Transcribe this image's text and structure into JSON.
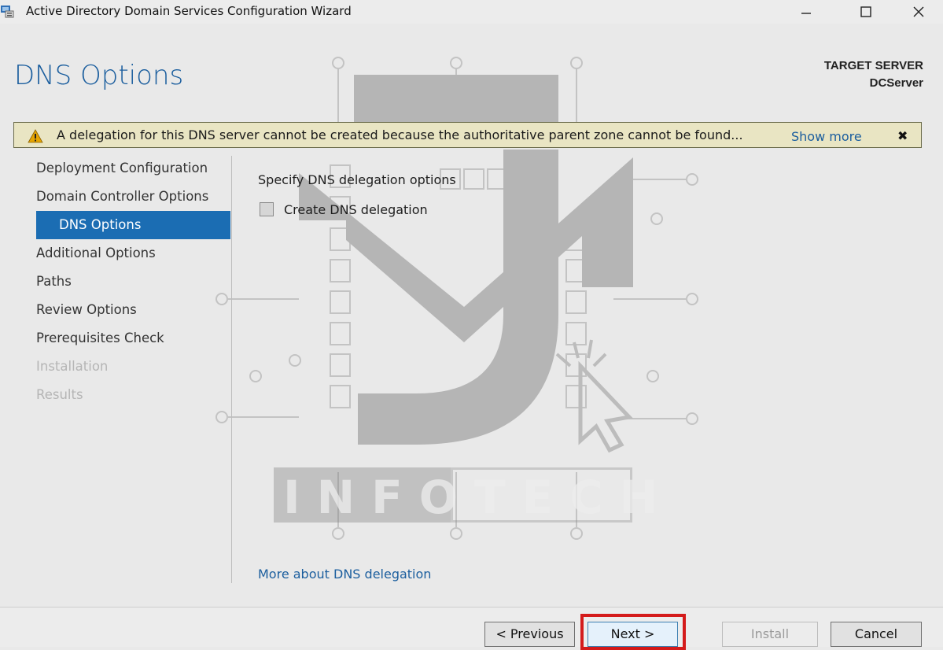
{
  "window": {
    "title": "Active Directory Domain Services Configuration Wizard",
    "controls": [
      "minimize-icon",
      "maximize-icon",
      "close-icon"
    ]
  },
  "header": {
    "page_title": "DNS Options",
    "target_label": "TARGET SERVER",
    "target_name": "DCServer"
  },
  "warning": {
    "icon": "warning-icon",
    "message": "A delegation for this DNS server cannot be created because the authoritative parent zone cannot be found...",
    "show_more": "Show more",
    "close_symbol": "✖"
  },
  "nav": {
    "items": [
      {
        "label": "Deployment Configuration",
        "state": "normal"
      },
      {
        "label": "Domain Controller Options",
        "state": "normal"
      },
      {
        "label": "DNS Options",
        "state": "selected"
      },
      {
        "label": "Additional Options",
        "state": "normal"
      },
      {
        "label": "Paths",
        "state": "normal"
      },
      {
        "label": "Review Options",
        "state": "normal"
      },
      {
        "label": "Prerequisites Check",
        "state": "normal"
      },
      {
        "label": "Installation",
        "state": "disabled"
      },
      {
        "label": "Results",
        "state": "disabled"
      }
    ]
  },
  "main": {
    "section_label": "Specify DNS delegation options",
    "checkbox_label": "Create DNS delegation",
    "checkbox_checked": false,
    "more_link": "More about DNS delegation"
  },
  "watermark": {
    "text": "INFOTECH"
  },
  "footer": {
    "previous": "< Previous",
    "next": "Next >",
    "install": "Install",
    "cancel": "Cancel"
  },
  "colors": {
    "accent": "#1b6db3",
    "title_blue": "#1b5e9e",
    "warning_bg": "#e9e5c3",
    "highlight_red": "#d41b1b"
  }
}
